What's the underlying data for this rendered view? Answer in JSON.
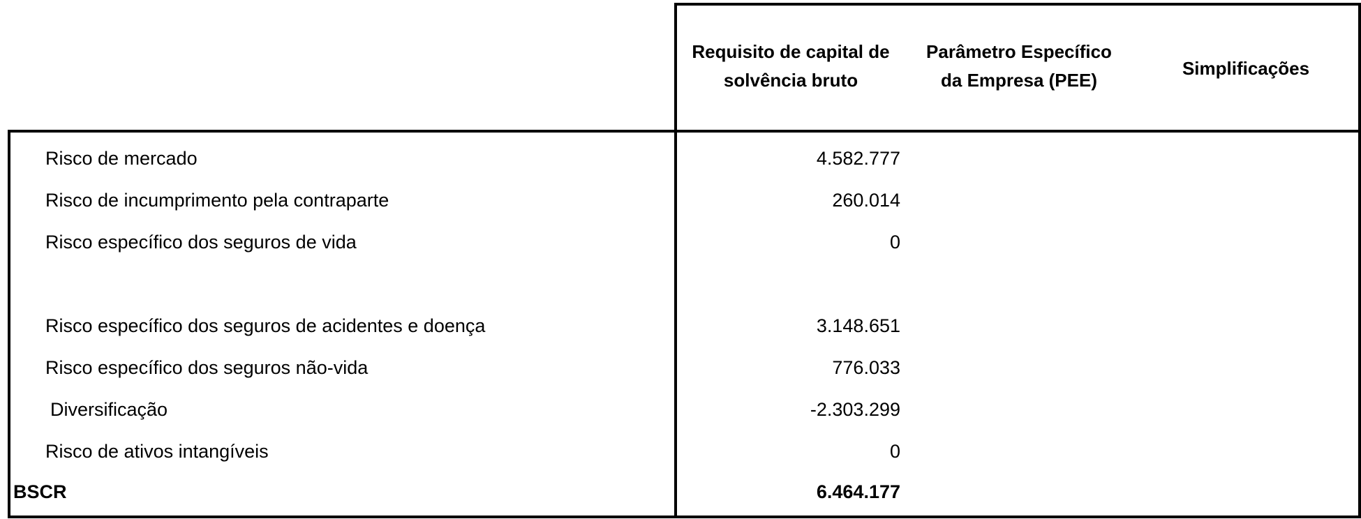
{
  "table": {
    "headers": {
      "gross_scr": [
        "Requisito de capital de",
        "solvência bruto"
      ],
      "usp": [
        "Parâmetro Específico",
        "da Empresa (PEE)"
      ],
      "simplifications": "Simplificações"
    },
    "rows": [
      {
        "label": "Risco de mercado",
        "value": "4.582.777"
      },
      {
        "label": "Risco de incumprimento pela contraparte",
        "value": "260.014"
      },
      {
        "label": "Risco específico dos seguros de vida",
        "value": "0"
      },
      {
        "label": "",
        "value": ""
      },
      {
        "label": "Risco específico dos seguros de acidentes e doença",
        "value": "3.148.651"
      },
      {
        "label": "Risco específico dos seguros não-vida",
        "value": "776.033"
      },
      {
        "label": "Diversificação",
        "value": "-2.303.299"
      },
      {
        "label": "Risco de ativos intangíveis",
        "value": "0"
      }
    ],
    "total": {
      "label": "BSCR",
      "value": "6.464.177"
    }
  }
}
